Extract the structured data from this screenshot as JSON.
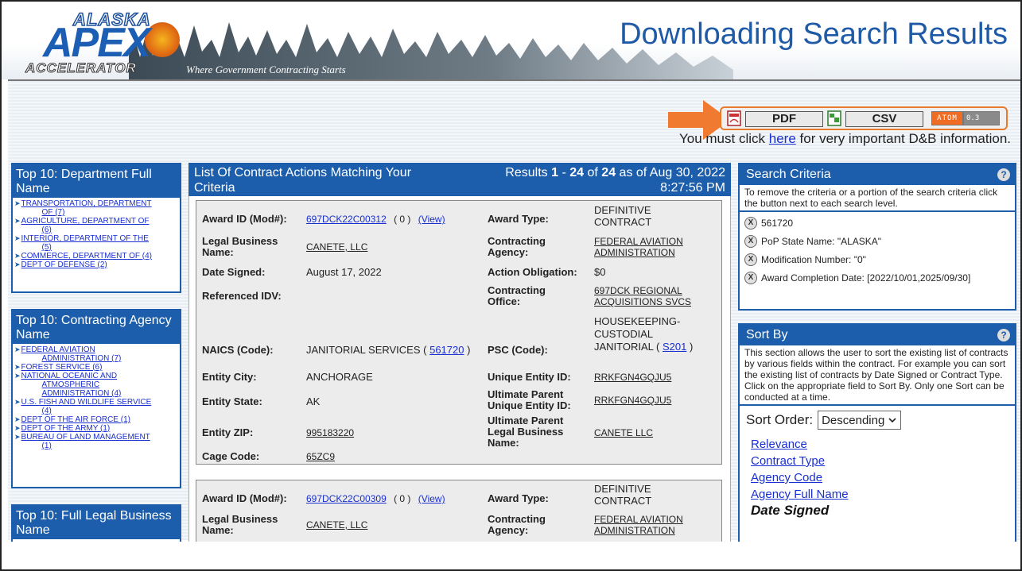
{
  "header": {
    "logo": {
      "alaska": "ALASKA",
      "apex": "APEX",
      "accelerator": "ACCELERATOR"
    },
    "tagline": "Where Government Contracting Starts",
    "title": "Downloading Search Results"
  },
  "export": {
    "pdf_label": "PDF",
    "csv_label": "CSV",
    "atom_label": "ATOM",
    "atom_version": "0.3",
    "note_before": "You must click",
    "note_link": "here",
    "note_after": "for very important D&B information."
  },
  "left": {
    "departments": {
      "title": "Top 10: Department Full Name",
      "items": [
        {
          "l1": "TRANSPORTATION, DEPARTMENT",
          "l2": "OF (7)"
        },
        {
          "l1": "AGRICULTURE, DEPARTMENT OF",
          "l2": "(6)"
        },
        {
          "l1": "INTERIOR, DEPARTMENT OF THE",
          "l2": "(5)"
        },
        {
          "l1": "COMMERCE, DEPARTMENT OF (4)",
          "l2": ""
        },
        {
          "l1": "DEPT OF DEFENSE (2)",
          "l2": ""
        }
      ]
    },
    "agencies": {
      "title": "Top 10: Contracting Agency Name",
      "items": [
        {
          "l1": "FEDERAL AVIATION",
          "l2": "ADMINISTRATION (7)",
          "l3": ""
        },
        {
          "l1": "FOREST SERVICE (6)",
          "l2": "",
          "l3": ""
        },
        {
          "l1": "NATIONAL OCEANIC AND",
          "l2": "ATMOSPHERIC",
          "l3": "ADMINISTRATION (4)"
        },
        {
          "l1": "U.S. FISH AND WILDLIFE SERVICE",
          "l2": "(4)",
          "l3": ""
        },
        {
          "l1": "DEPT OF THE AIR FORCE (1)",
          "l2": "",
          "l3": ""
        },
        {
          "l1": "DEPT OF THE ARMY (1)",
          "l2": "",
          "l3": ""
        },
        {
          "l1": "BUREAU OF LAND MANAGEMENT",
          "l2": "(1)",
          "l3": ""
        }
      ]
    },
    "legal_names": {
      "title": "Top 10: Full Legal Business Name"
    }
  },
  "results": {
    "head_left": "List Of Contract Actions Matching Your Criteria",
    "head_results": "Results",
    "range_start": "1",
    "range_dash": "-",
    "range_end": "24",
    "of": "of",
    "total": "24",
    "as_of": "as of Aug 30, 2022",
    "time": "8:27:56 PM",
    "labels": {
      "award_id": "Award ID (Mod#):",
      "legal_business": "Legal Business",
      "name": "Name:",
      "date_signed": "Date Signed:",
      "ref_idv": "Referenced IDV:",
      "naics": "NAICS (Code):",
      "entity_city": "Entity City:",
      "entity_state": "Entity State:",
      "entity_zip": "Entity ZIP:",
      "cage": "Cage Code:",
      "award_type": "Award Type:",
      "contracting": "Contracting",
      "agency": "Agency:",
      "action_obligation": "Action Obligation:",
      "office": "Office:",
      "psc": "PSC (Code):",
      "uei": "Unique Entity ID:",
      "ult_parent": "Ultimate Parent",
      "ult_uei": "Unique Entity ID:",
      "ult_legal": "Legal Business",
      "ult_name": "Name:"
    },
    "records": [
      {
        "award_id": "697DCK22C00312",
        "mod": "( 0 )",
        "view": "(View)",
        "legal_name": "CANETE, LLC",
        "date_signed": "August 17, 2022",
        "naics_text": "JANITORIAL SERVICES (",
        "naics_code": "561720",
        "naics_close": ")",
        "city": "ANCHORAGE",
        "state": "AK",
        "zip": "995183220",
        "cage": "65ZC9",
        "award_type_1": "DEFINITIVE",
        "award_type_2": "CONTRACT",
        "agency_1": "FEDERAL AVIATION",
        "agency_2": "ADMINISTRATION",
        "obligation": "$0",
        "office_1": "697DCK REGIONAL",
        "office_2": "ACQUISITIONS SVCS",
        "psc_1": "HOUSEKEEPING-",
        "psc_2": "CUSTODIAL",
        "psc_3": "JANITORIAL (",
        "psc_code": "S201",
        "psc_close": ")",
        "uei": "RRKFGN4GQJU5",
        "ult_uei": "RRKFGN4GQJU5",
        "ult_name": "CANETE LLC"
      },
      {
        "award_id": "697DCK22C00309",
        "mod": "( 0 )",
        "view": "(View)",
        "legal_name": "CANETE, LLC",
        "award_type_1": "DEFINITIVE",
        "award_type_2": "CONTRACT",
        "agency_1": "FEDERAL AVIATION",
        "agency_2": "ADMINISTRATION"
      }
    ]
  },
  "criteria": {
    "title": "Search Criteria",
    "help": "?",
    "desc": "To remove the criteria or a portion of the search criteria click the button next to each search level.",
    "x": "X",
    "items": [
      "561720",
      "PoP State Name: \"ALASKA\"",
      "Modification Number: \"0\"",
      "Award Completion Date: [2022/10/01,2025/09/30]"
    ]
  },
  "sort": {
    "title": "Sort By",
    "help": "?",
    "desc": "This section allows the user to sort the existing list of contracts by various fields within the contract. For example you can sort the existing list of contracts by Date Signed or Contract Type. Click on the appropriate field to Sort By. Only one Sort can be conducted at a time.",
    "order_label": "Sort Order:",
    "order_value": "Descending",
    "options": [
      "Relevance",
      "Contract Type",
      "Agency Code",
      "Agency Full Name"
    ],
    "active": "Date Signed"
  },
  "colors": {
    "brand_blue": "#1c5eab",
    "accent_orange": "#e87a2c",
    "link_blue": "#1a2fd0"
  }
}
